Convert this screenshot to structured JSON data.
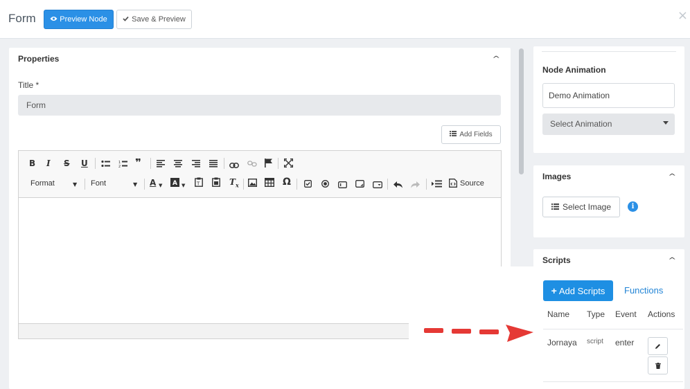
{
  "header": {
    "title": "Form",
    "preview_label": "Preview Node",
    "save_label": "Save & Preview",
    "close_glyph": "×"
  },
  "properties": {
    "heading": "Properties",
    "title_label": "Title *",
    "title_value": "Form",
    "add_fields_label": "Add Fields"
  },
  "editor": {
    "format_label": "Format",
    "font_label": "Font",
    "source_label": "Source"
  },
  "node_animation": {
    "heading": "Node Animation",
    "name_value": "Demo Animation",
    "select_value": "Select Animation"
  },
  "images": {
    "heading": "Images",
    "select_label": "Select Image"
  },
  "scripts": {
    "heading": "Scripts",
    "add_label": "Add Scripts",
    "functions_label": "Functions",
    "columns": [
      "Name",
      "Type",
      "Event",
      "Actions"
    ],
    "rows": [
      {
        "name": "Jornaya",
        "type": "script",
        "event": "enter"
      }
    ]
  },
  "colors": {
    "primary": "#2b90e6",
    "arrow": "#e53935"
  }
}
